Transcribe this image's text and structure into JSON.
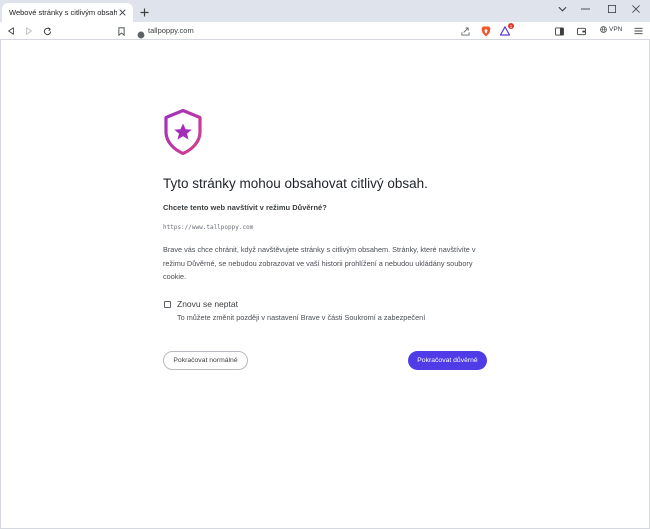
{
  "browser": {
    "tab_title": "Webové stránky s citlivým obsahem",
    "url": "tallpoppy.com",
    "vpn_label": "VPN",
    "rewards_badge": "1"
  },
  "page": {
    "title": "Tyto stránky mohou obsahovat citlivý obsah.",
    "subtitle": "Chcete tento web navštívit v režimu Důvěrné?",
    "url_display": "https://www.tallpoppy.com",
    "description": "Brave vás chce chránit, když navštěvujete stránky s citlivým obsahem. Stránky, které navštívíte v režimu Důvěrné, se nebudou zobrazovat ve vaší historii prohlížení a nebudou ukládány soubory cookie.",
    "checkbox_label": "Znovu se neptat",
    "checkbox_checked": false,
    "checkbox_hint": "To můžete změnit později v nastavení Brave v části Soukromí a zabezpečení",
    "button_normal": "Pokračovat normálně",
    "button_private": "Pokračovat důvěrně"
  },
  "colors": {
    "accent": "#4f3ce6",
    "shield_gradient_start": "#a02ec2",
    "shield_gradient_end": "#d64286"
  }
}
